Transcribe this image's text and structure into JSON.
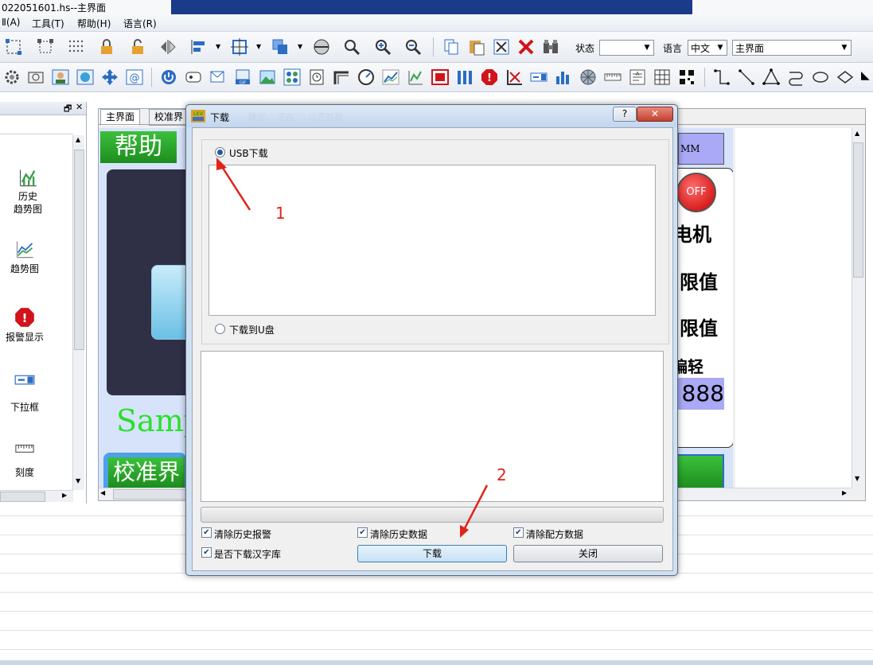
{
  "window": {
    "title": "022051601.hs--主界面"
  },
  "menubar": {
    "items": [
      "Ⅱ(A)",
      "工具(T)",
      "帮助(H)",
      "语言(R)"
    ]
  },
  "toolbar": {
    "state_label": "状态",
    "state_value": "",
    "language_label": "语言",
    "language_value": "中文",
    "screen_value": "主界面"
  },
  "left_panel": {
    "items": [
      {
        "label": "历史\n趋势图",
        "icon": "history-trend-icon"
      },
      {
        "label": "趋势图",
        "icon": "trend-chart-icon"
      },
      {
        "label": "报警显示",
        "icon": "alarm-display-icon"
      },
      {
        "label": "下拉框",
        "icon": "dropdown-icon"
      },
      {
        "label": "刻度",
        "icon": "scale-icon"
      }
    ]
  },
  "workspace": {
    "tabs": [
      "主界面",
      "校准界"
    ],
    "canvas": {
      "help_button": "帮助",
      "motor_label": "电机",
      "limit_label_1": "限值",
      "limit_label_2": "限值",
      "partial_label": "偏轻",
      "number_display": "888",
      "sample_text": "Samp",
      "calib_button": "校准界",
      "off_label": "OFF",
      "mm_label": "MM"
    }
  },
  "dialog": {
    "title": "下载",
    "title_ghost": "确定... 正在 ... 以正在确",
    "usb_option": "USB下载",
    "udisk_option": "下载到U盘",
    "checks": [
      {
        "label": "清除历史报警",
        "checked": true
      },
      {
        "label": "清除历史数据",
        "checked": true
      },
      {
        "label": "清除配方数据",
        "checked": true
      },
      {
        "label": "是否下载汉字库",
        "checked": true
      }
    ],
    "download_button": "下载",
    "close_button": "关闭",
    "help_button": "?",
    "close_x": "✕"
  },
  "annotations": {
    "marker_1": "1",
    "marker_2": "2",
    "color": "#e2231a"
  }
}
